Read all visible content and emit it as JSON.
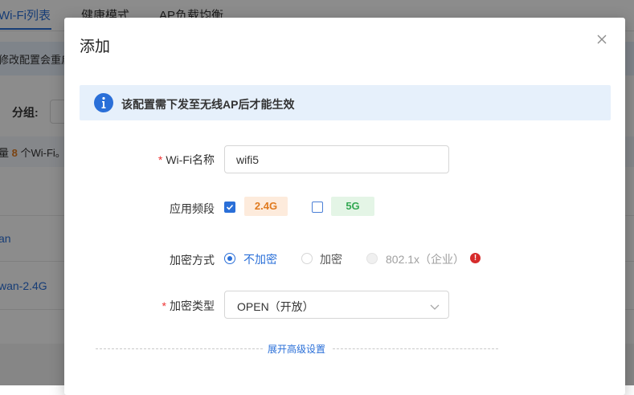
{
  "background": {
    "tabs": [
      "Wi-Fi列表",
      "健康模式",
      "AP负载均衡"
    ],
    "notice_text": "修改配置会重启",
    "group_label": "分组:",
    "count_prefix": "量 ",
    "count_value": "8",
    "count_suffix": " 个Wi-Fi。",
    "rows": [
      "an",
      "wan-2.4G"
    ]
  },
  "modal": {
    "title": "添加",
    "close_icon": "close-icon",
    "alert": {
      "icon": "info-icon",
      "text": "该配置需下发至无线AP后才能生效"
    },
    "fields": {
      "wifi_name": {
        "label": "Wi-Fi名称",
        "required_mark": "*",
        "value": "wifi5"
      },
      "band": {
        "label": "应用频段",
        "options": [
          {
            "label": "2.4G",
            "checked": true,
            "color": "#e07a1f"
          },
          {
            "label": "5G",
            "checked": false,
            "color": "#34a853"
          }
        ]
      },
      "encryption_mode": {
        "label": "加密方式",
        "options": [
          {
            "label": "不加密",
            "state": "selected"
          },
          {
            "label": "加密",
            "state": "unselected"
          },
          {
            "label": "802.1x（企业）",
            "state": "disabled"
          }
        ],
        "warning_icon": "warning-icon"
      },
      "encryption_type": {
        "label": "加密类型",
        "required_mark": "*",
        "value": "OPEN（开放）",
        "icon": "chevron-down-icon"
      }
    },
    "advanced_link": "展开高级设置"
  },
  "colors": {
    "accent": "#2a6fd8",
    "required": "#e33333",
    "warning": "#d62b2b"
  }
}
